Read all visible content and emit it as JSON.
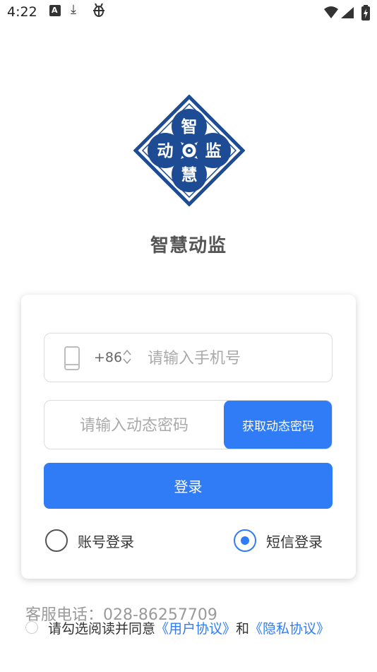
{
  "status_bar": {
    "time": "4:22",
    "icons": [
      "a-notification-icon",
      "download-icon",
      "bug-icon",
      "wifi-icon",
      "signal-icon",
      "battery-icon"
    ]
  },
  "logo": {
    "chars": {
      "top": "智",
      "left": "动",
      "right": "监",
      "bottom": "慧"
    },
    "colors": {
      "primary": "#1e4c94",
      "background": "#ffffff"
    }
  },
  "app_title": "智慧动监",
  "login_form": {
    "country_code": "+86",
    "phone_placeholder": "请输入手机号",
    "code_placeholder": "请输入动态密码",
    "get_code_label": "获取动态密码",
    "login_label": "登录",
    "modes": [
      {
        "label": "账号登录",
        "selected": false
      },
      {
        "label": "短信登录",
        "selected": true
      }
    ]
  },
  "service_phone": "客服电话：028-86257709",
  "agreement": {
    "prefix": "请勾选阅读并同意",
    "user_agreement": "《用户协议》",
    "and": "和",
    "privacy_policy": "《隐私协议》",
    "checked": false
  },
  "colors": {
    "accent": "#2f7cf6",
    "logo": "#1e4c94"
  }
}
